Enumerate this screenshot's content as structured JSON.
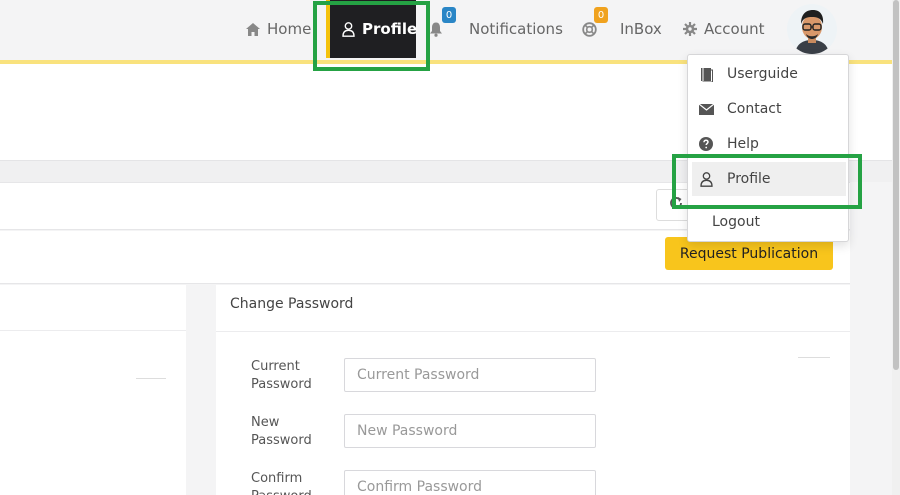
{
  "nav": {
    "home": {
      "label": "Home",
      "icon": "home-icon"
    },
    "profile": {
      "label": "Profile",
      "icon": "user-icon"
    },
    "notifications": {
      "label": "Notifications",
      "icon": "bell-icon",
      "badge": "0"
    },
    "inbox": {
      "label": "InBox",
      "icon": "support-icon",
      "badge": "0"
    },
    "account": {
      "label": "Account",
      "icon": "gear-icon"
    }
  },
  "dropdown": {
    "items": [
      {
        "label": "Userguide",
        "icon": "book-icon"
      },
      {
        "label": "Contact",
        "icon": "envelope-icon"
      },
      {
        "label": "Help",
        "icon": "question-circle-icon"
      },
      {
        "label": "Profile",
        "icon": "user-icon"
      },
      {
        "label": "Logout",
        "icon": ""
      }
    ]
  },
  "toolbar": {
    "request_publication": "Request Publication",
    "refresh_icon": "refresh-icon"
  },
  "change_password": {
    "title": "Change Password",
    "fields": [
      {
        "label": "Current Password",
        "placeholder": "Current Password"
      },
      {
        "label": "New Password",
        "placeholder": "New Password"
      },
      {
        "label": "Confirm Password",
        "placeholder": "Confirm Password"
      }
    ]
  },
  "colors": {
    "accent_yellow": "#f8c51c",
    "nav_active_bg": "#1f1f22",
    "highlight_green": "#25a244",
    "badge_blue": "#2a86c6",
    "badge_orange": "#f0a21e"
  }
}
